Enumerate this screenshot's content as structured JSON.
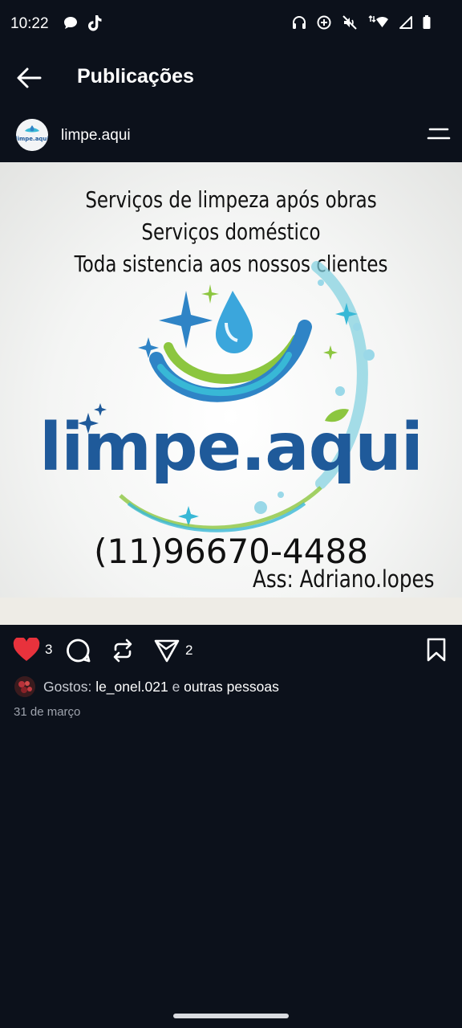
{
  "status_bar": {
    "time": "10:22",
    "left_icons": [
      "chat-bubble-icon",
      "tiktok-icon"
    ],
    "right_icons": [
      "headphones-icon",
      "data-saver-icon",
      "mute-icon",
      "wifi-icon",
      "signal-icon",
      "battery-icon"
    ]
  },
  "header": {
    "title": "Publicações",
    "back_icon": "arrow-left-icon"
  },
  "post": {
    "author": "limpe.aqui",
    "avatar_text": "limpe.aqui",
    "menu_icon": "menu-icon",
    "image": {
      "lines": [
        "Serviços de limpeza após obras",
        "Serviços doméstico",
        "Toda sistencia aos nossos clientes"
      ],
      "brand": "limpe.aqui",
      "phone": "(11)96670-4488",
      "signature": "Ass: Adriano.lopes"
    },
    "actions": {
      "like_count": "3",
      "share_count": "2",
      "like_color": "#e8323c"
    },
    "likes": {
      "label": "Gostos:",
      "user": "le_onel.021",
      "connector": "e",
      "others": "outras pessoas"
    },
    "date": "31 de março"
  },
  "colors": {
    "background": "#0c111b",
    "brand_blue": "#1f5a9a",
    "accent_teal": "#38b8d6",
    "accent_green": "#8cc63f"
  }
}
